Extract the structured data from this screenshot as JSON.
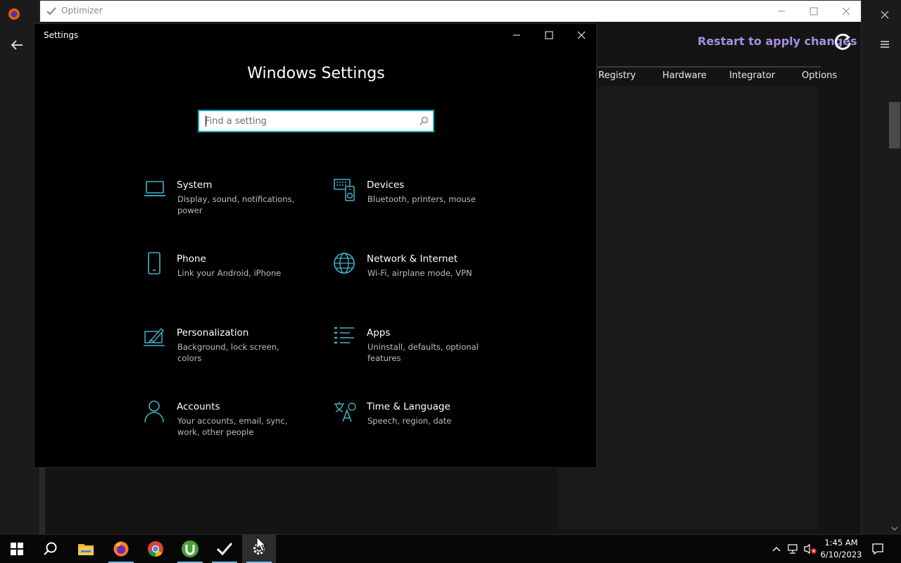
{
  "optimizer": {
    "title": "Optimizer",
    "restart_label": "Restart to apply changes",
    "tabs": [
      "Registry",
      "Hardware",
      "Integrator",
      "Options"
    ]
  },
  "settings": {
    "window_title": "Settings",
    "heading": "Windows Settings",
    "search": {
      "placeholder": "Find a setting",
      "value": ""
    },
    "tiles": [
      {
        "name": "System",
        "desc": "Display, sound, notifications, power",
        "icon": "laptop-icon"
      },
      {
        "name": "Devices",
        "desc": "Bluetooth, printers, mouse",
        "icon": "devices-icon"
      },
      {
        "name": "Phone",
        "desc": "Link your Android, iPhone",
        "icon": "phone-icon"
      },
      {
        "name": "Network & Internet",
        "desc": "Wi-Fi, airplane mode, VPN",
        "icon": "globe-icon"
      },
      {
        "name": "Personalization",
        "desc": "Background, lock screen, colors",
        "icon": "personalization-icon"
      },
      {
        "name": "Apps",
        "desc": "Uninstall, defaults, optional features",
        "icon": "apps-list-icon"
      },
      {
        "name": "Accounts",
        "desc": "Your accounts, email, sync, work, other people",
        "icon": "person-icon"
      },
      {
        "name": "Time & Language",
        "desc": "Speech, region, date",
        "icon": "time-language-icon"
      }
    ]
  },
  "taskbar": {
    "time": "1:45 AM",
    "date": "6/10/2023"
  },
  "colors": {
    "accent": "#1ea4c0",
    "icon_teal": "#3fb3c9",
    "restart_purple": "#a68fe0"
  }
}
